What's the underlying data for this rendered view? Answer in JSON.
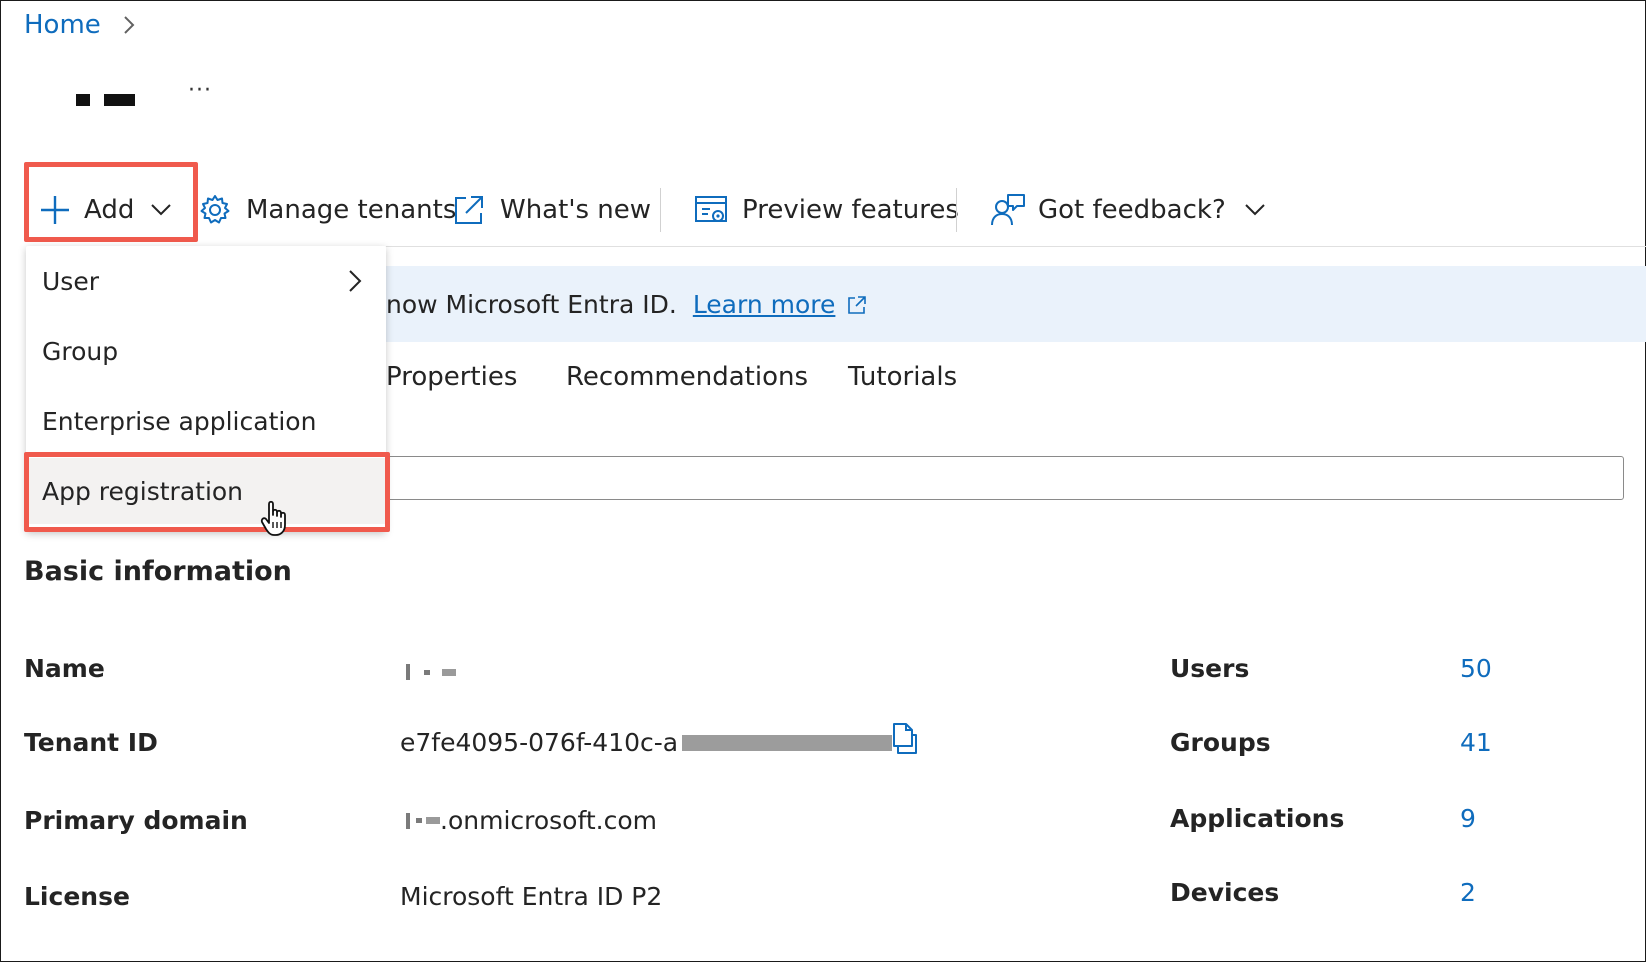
{
  "breadcrumb": {
    "home": "Home"
  },
  "header": {
    "more": "···"
  },
  "toolbar": {
    "add": "Add",
    "manage_tenants": "Manage tenants",
    "whats_new": "What's new",
    "preview_features": "Preview features",
    "got_feedback": "Got feedback?"
  },
  "add_menu": {
    "items": [
      {
        "label": "User",
        "has_submenu": true
      },
      {
        "label": "Group"
      },
      {
        "label": "Enterprise application"
      },
      {
        "label": "App registration",
        "hovered": true
      }
    ]
  },
  "banner": {
    "text": "now Microsoft Entra ID.",
    "link": "Learn more"
  },
  "tabs": [
    "Properties",
    "Recommendations",
    "Tutorials"
  ],
  "basic_info": {
    "title": "Basic information",
    "fields": [
      {
        "label": "Name",
        "value": ""
      },
      {
        "label": "Tenant ID",
        "value": "e7fe4095-076f-410c-a"
      },
      {
        "label": "Primary domain",
        "value": ".onmicrosoft.com"
      },
      {
        "label": "License",
        "value": "Microsoft Entra ID P2"
      }
    ],
    "stats": [
      {
        "label": "Users",
        "value": "50"
      },
      {
        "label": "Groups",
        "value": "41"
      },
      {
        "label": "Applications",
        "value": "9"
      },
      {
        "label": "Devices",
        "value": "2"
      }
    ]
  },
  "colors": {
    "accent": "#0f6cbd",
    "highlight": "#f05a4d",
    "banner_bg": "#eaf2fb"
  }
}
